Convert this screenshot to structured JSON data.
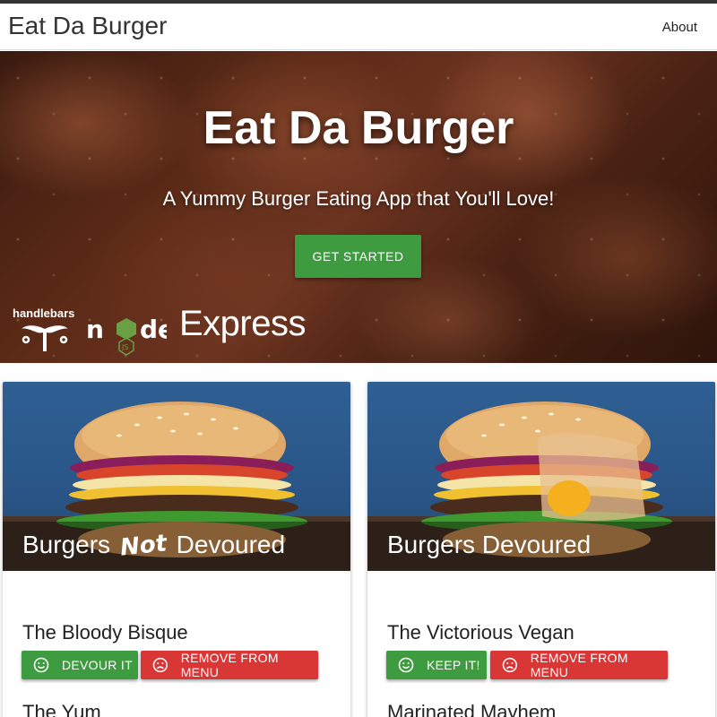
{
  "navbar": {
    "brand": "Eat Da Burger",
    "about": "About"
  },
  "hero": {
    "title": "Eat Da Burger",
    "subtitle": "A Yummy Burger Eating App that You'll Love!",
    "cta_label": "GET STARTED",
    "logos": {
      "handlebars": "handlebars",
      "node": "node",
      "express": "Express"
    }
  },
  "cards": {
    "not_devoured": {
      "title_before": "Burgers",
      "title_accent": "Not",
      "title_after": "Devoured",
      "items": [
        {
          "name": "The Bloody Bisque",
          "primary_label": "DEVOUR IT",
          "secondary_label": "REMOVE FROM MENU"
        },
        {
          "name": "The Yum"
        }
      ]
    },
    "devoured": {
      "title": "Burgers Devoured",
      "items": [
        {
          "name": "The Victorious Vegan",
          "primary_label": "KEEP IT!",
          "secondary_label": "REMOVE FROM MENU"
        },
        {
          "name": "Marinated Mayhem"
        }
      ]
    }
  },
  "colors": {
    "green": "#3f9b3f",
    "red": "#d93636"
  },
  "icons": {
    "smile": "smile-icon",
    "frown": "frown-icon"
  }
}
